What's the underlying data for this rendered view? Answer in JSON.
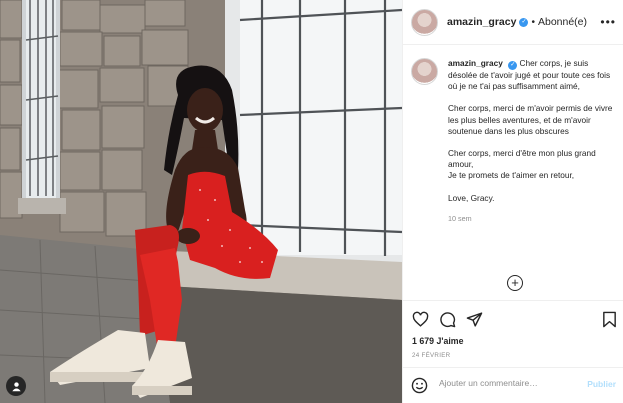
{
  "header": {
    "username": "amazin_gracy",
    "separator": "•",
    "follow_status": "Abonné(e)"
  },
  "caption": {
    "username": "amazin_gracy",
    "paragraphs": [
      "Cher corps, je suis désolée de t'avoir jugé et pour toute ces fois où je ne t'ai pas suffisamment aimé,",
      "Cher corps, merci de m'avoir permis de vivre les plus belles aventures, et de m'avoir soutenue dans les plus obscures",
      "Cher corps, merci d'être mon plus grand amour,",
      "Je te promets de t'aimer en retour,",
      "Love, Gracy."
    ],
    "time_ago": "10 sem"
  },
  "actions": {
    "likes": "1 679 J'aime",
    "date": "24 FÉVRIER"
  },
  "comment": {
    "placeholder": "Ajouter un commentaire…",
    "post_label": "Publier"
  },
  "icons": {
    "verified": "verified-badge-icon",
    "more": "more-options-icon",
    "add": "plus-circle-icon",
    "like": "heart-icon",
    "comment": "comment-icon",
    "share": "paper-plane-icon",
    "save": "bookmark-icon",
    "emoji": "emoji-icon",
    "user_tag": "user-tag-icon"
  },
  "colors": {
    "accent": "#3897f0",
    "post_disabled": "#b2dffc",
    "dress": "#d9201f",
    "border": "#efefef"
  }
}
